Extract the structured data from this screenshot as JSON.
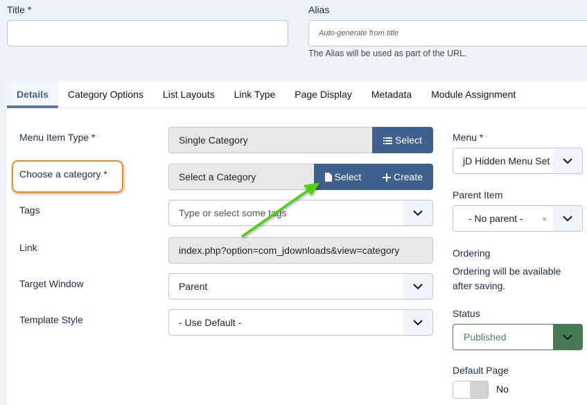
{
  "title_field": {
    "label": "Title *",
    "value": ""
  },
  "alias_field": {
    "label": "Alias",
    "placeholder": "Auto-generate from title",
    "help": "The Alias will be used as part of the URL."
  },
  "tabs": [
    {
      "label": "Details",
      "active": true
    },
    {
      "label": "Category Options"
    },
    {
      "label": "List Layouts"
    },
    {
      "label": "Link Type"
    },
    {
      "label": "Page Display"
    },
    {
      "label": "Metadata"
    },
    {
      "label": "Module Assignment"
    }
  ],
  "details": {
    "menu_item_type": {
      "label": "Menu Item Type *",
      "value": "Single Category",
      "button": "Select",
      "icon": "list-icon"
    },
    "choose_category": {
      "label": "Choose a category *",
      "value": "Select a Category",
      "select_button": "Select",
      "select_icon": "file-icon",
      "create_button": "Create",
      "create_icon": "plus-icon"
    },
    "tags": {
      "label": "Tags",
      "placeholder": "Type or select some tags"
    },
    "link": {
      "label": "Link",
      "value": "index.php?option=com_jdownloads&view=category"
    },
    "target_window": {
      "label": "Target Window",
      "value": "Parent"
    },
    "template_style": {
      "label": "Template Style",
      "value": "- Use Default -"
    }
  },
  "sidebar": {
    "menu": {
      "label": "Menu *",
      "value": "jD Hidden Menu Set"
    },
    "parent_item": {
      "label": "Parent Item",
      "value": "- No parent -",
      "clear": "×"
    },
    "ordering": {
      "label": "Ordering",
      "text": "Ordering will be available after saving."
    },
    "status": {
      "label": "Status",
      "value": "Published"
    },
    "default_page": {
      "label": "Default Page",
      "value": "No"
    }
  },
  "colors": {
    "accent_blue": "#3f5f8d",
    "highlight_orange": "#f28a1e",
    "annotation_arrow_green": "#4fcf14",
    "status_green": "#457a54"
  }
}
